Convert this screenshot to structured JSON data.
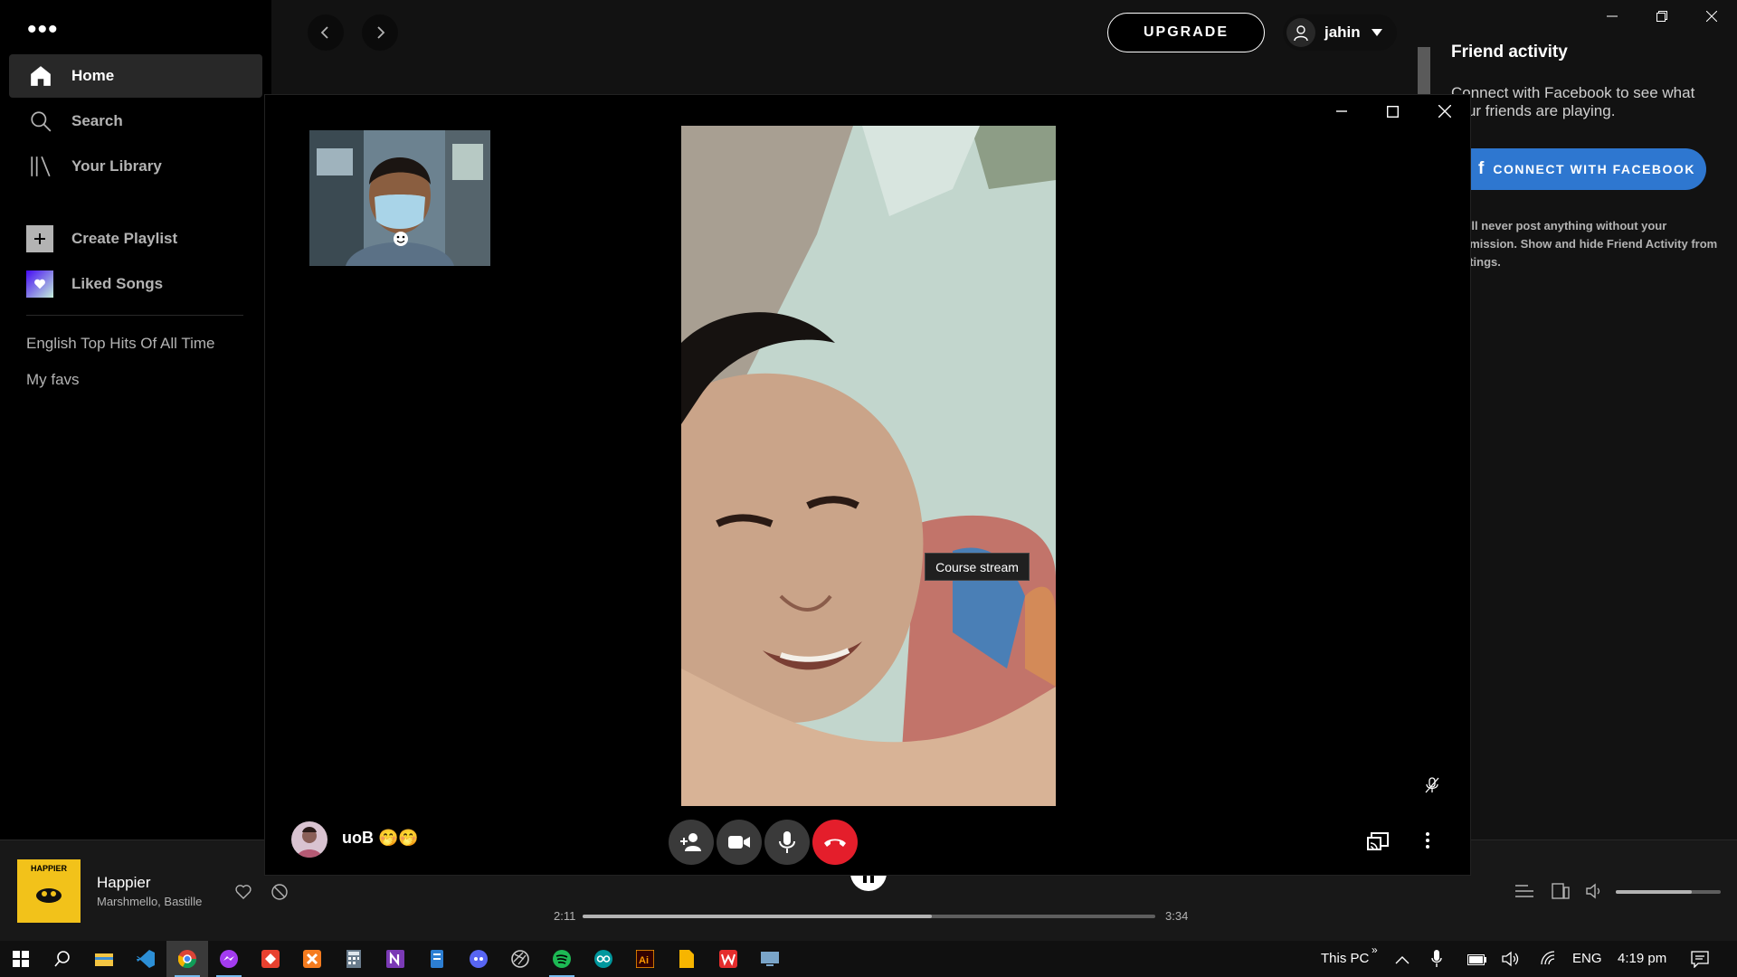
{
  "sidebar": {
    "nav": [
      "Home",
      "Search",
      "Your Library"
    ],
    "actions": [
      "Create Playlist",
      "Liked Songs"
    ],
    "playlists": [
      "English Top Hits Of All Time",
      "My favs"
    ]
  },
  "topbar": {
    "upgrade_label": "UPGRADE",
    "username": "jahin"
  },
  "friend_activity": {
    "title": "Friend activity",
    "description": "Connect with Facebook to see what your friends are playing.",
    "connect_label": "CONNECT WITH FACEBOOK",
    "note": "We'll never post anything without your permission. Show and hide Friend Activity from Settings."
  },
  "call": {
    "caller_name": "uoB 🤭🤭",
    "tooltip": "Course stream"
  },
  "player": {
    "title": "Happier",
    "artist": "Marshmello, Bastille",
    "cover_text": "HAPPIER",
    "elapsed": "2:11",
    "duration": "3:34",
    "progress_fraction": 0.61,
    "volume_fraction": 0.72
  },
  "taskbar": {
    "location": "This PC",
    "language": "ENG",
    "clock": "4:19 pm"
  },
  "colors": {
    "accent_green": "#1db954",
    "facebook_blue": "#2e77d0",
    "end_call_red": "#e41e2b"
  }
}
